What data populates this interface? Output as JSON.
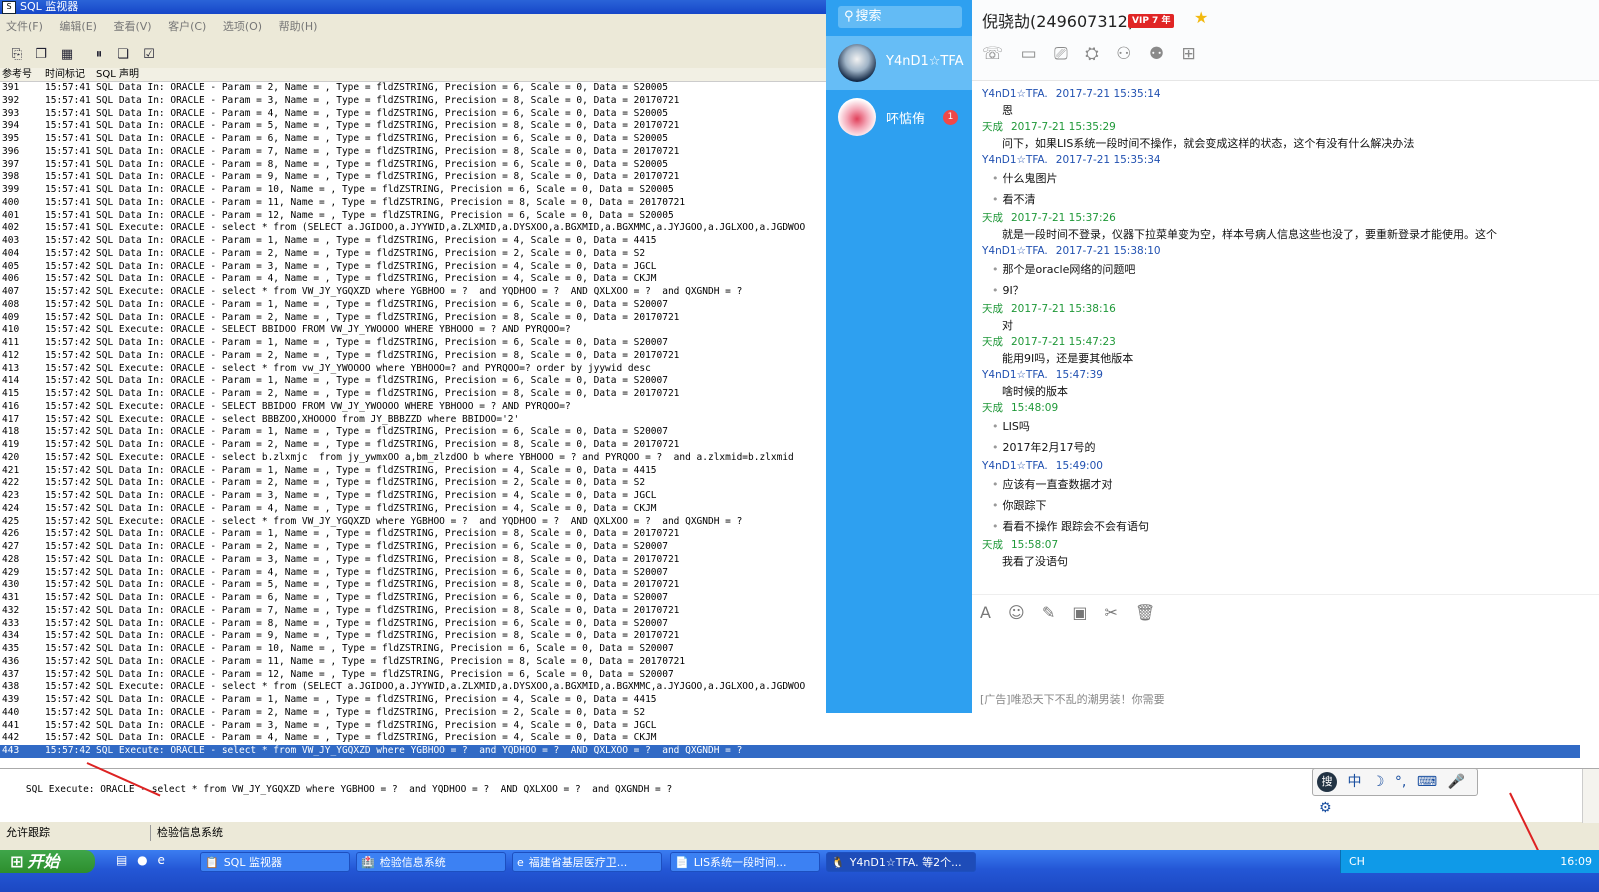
{
  "sql_window": {
    "title": "SQL 监视器",
    "menu": [
      "文件(F)",
      "编辑(E)",
      "查看(V)",
      "客户(C)",
      "选项(O)",
      "帮助(H)"
    ],
    "columns": [
      "参考号",
      "时间标记",
      "SQL 声明"
    ],
    "rows": [
      [
        "391",
        "15:57:41",
        "SQL Data In: ORACLE - Param = 2, Name = , Type = fldZSTRING, Precision = 6, Scale = 0, Data = S20005"
      ],
      [
        "392",
        "15:57:41",
        "SQL Data In: ORACLE - Param = 3, Name = , Type = fldZSTRING, Precision = 8, Scale = 0, Data = 20170721"
      ],
      [
        "393",
        "15:57:41",
        "SQL Data In: ORACLE - Param = 4, Name = , Type = fldZSTRING, Precision = 6, Scale = 0, Data = S20005"
      ],
      [
        "394",
        "15:57:41",
        "SQL Data In: ORACLE - Param = 5, Name = , Type = fldZSTRING, Precision = 8, Scale = 0, Data = 20170721"
      ],
      [
        "395",
        "15:57:41",
        "SQL Data In: ORACLE - Param = 6, Name = , Type = fldZSTRING, Precision = 6, Scale = 0, Data = S20005"
      ],
      [
        "396",
        "15:57:41",
        "SQL Data In: ORACLE - Param = 7, Name = , Type = fldZSTRING, Precision = 8, Scale = 0, Data = 20170721"
      ],
      [
        "397",
        "15:57:41",
        "SQL Data In: ORACLE - Param = 8, Name = , Type = fldZSTRING, Precision = 6, Scale = 0, Data = S20005"
      ],
      [
        "398",
        "15:57:41",
        "SQL Data In: ORACLE - Param = 9, Name = , Type = fldZSTRING, Precision = 8, Scale = 0, Data = 20170721"
      ],
      [
        "399",
        "15:57:41",
        "SQL Data In: ORACLE - Param = 10, Name = , Type = fldZSTRING, Precision = 6, Scale = 0, Data = S20005"
      ],
      [
        "400",
        "15:57:41",
        "SQL Data In: ORACLE - Param = 11, Name = , Type = fldZSTRING, Precision = 8, Scale = 0, Data = 20170721"
      ],
      [
        "401",
        "15:57:41",
        "SQL Data In: ORACLE - Param = 12, Name = , Type = fldZSTRING, Precision = 6, Scale = 0, Data = S20005"
      ],
      [
        "402",
        "15:57:41",
        "SQL Execute: ORACLE - select * from (SELECT a.JGIDOO,a.JYYWID,a.ZLXMID,a.DYSXOO,a.BGXMID,a.BGXMMC,a.JYJGOO,a.JGLXOO,a.JGDWOO"
      ],
      [
        "403",
        "15:57:42",
        "SQL Data In: ORACLE - Param = 1, Name = , Type = fldZSTRING, Precision = 4, Scale = 0, Data = 4415"
      ],
      [
        "404",
        "15:57:42",
        "SQL Data In: ORACLE - Param = 2, Name = , Type = fldZSTRING, Precision = 2, Scale = 0, Data = S2"
      ],
      [
        "405",
        "15:57:42",
        "SQL Data In: ORACLE - Param = 3, Name = , Type = fldZSTRING, Precision = 4, Scale = 0, Data = JGCL"
      ],
      [
        "406",
        "15:57:42",
        "SQL Data In: ORACLE - Param = 4, Name = , Type = fldZSTRING, Precision = 4, Scale = 0, Data = CKJM"
      ],
      [
        "407",
        "15:57:42",
        "SQL Execute: ORACLE - select * from VW_JY_YGQXZD where YGBHOO = ?  and YQDHOO = ?  AND QXLXOO = ?  and QXGNDH = ?"
      ],
      [
        "408",
        "15:57:42",
        "SQL Data In: ORACLE - Param = 1, Name = , Type = fldZSTRING, Precision = 6, Scale = 0, Data = S20007"
      ],
      [
        "409",
        "15:57:42",
        "SQL Data In: ORACLE - Param = 2, Name = , Type = fldZSTRING, Precision = 8, Scale = 0, Data = 20170721"
      ],
      [
        "410",
        "15:57:42",
        "SQL Execute: ORACLE - SELECT BBIDOO FROM VW_JY_YWOOOO WHERE YBHOOO = ? AND PYRQOO=?"
      ],
      [
        "411",
        "15:57:42",
        "SQL Data In: ORACLE - Param = 1, Name = , Type = fldZSTRING, Precision = 6, Scale = 0, Data = S20007"
      ],
      [
        "412",
        "15:57:42",
        "SQL Data In: ORACLE - Param = 2, Name = , Type = fldZSTRING, Precision = 8, Scale = 0, Data = 20170721"
      ],
      [
        "413",
        "15:57:42",
        "SQL Execute: ORACLE - select * from vw_JY_YWOOOO where YBHOOO=? and PYRQOO=? order by jyywid desc"
      ],
      [
        "414",
        "15:57:42",
        "SQL Data In: ORACLE - Param = 1, Name = , Type = fldZSTRING, Precision = 6, Scale = 0, Data = S20007"
      ],
      [
        "415",
        "15:57:42",
        "SQL Data In: ORACLE - Param = 2, Name = , Type = fldZSTRING, Precision = 8, Scale = 0, Data = 20170721"
      ],
      [
        "416",
        "15:57:42",
        "SQL Execute: ORACLE - SELECT BBIDOO FROM VW_JY_YWOOOO WHERE YBHOOO = ? AND PYRQOO=?"
      ],
      [
        "417",
        "15:57:42",
        "SQL Execute: ORACLE - select BBBZOO,XHOOOO from JY_BBBZZD where BBIDOO='2'"
      ],
      [
        "418",
        "15:57:42",
        "SQL Data In: ORACLE - Param = 1, Name = , Type = fldZSTRING, Precision = 6, Scale = 0, Data = S20007"
      ],
      [
        "419",
        "15:57:42",
        "SQL Data In: ORACLE - Param = 2, Name = , Type = fldZSTRING, Precision = 8, Scale = 0, Data = 20170721"
      ],
      [
        "420",
        "15:57:42",
        "SQL Execute: ORACLE - select b.zlxmjc  from jy_ywmxOO a,bm_zlzdOO b where YBHOOO = ? and PYRQOO = ?  and a.zlxmid=b.zlxmid"
      ],
      [
        "421",
        "15:57:42",
        "SQL Data In: ORACLE - Param = 1, Name = , Type = fldZSTRING, Precision = 4, Scale = 0, Data = 4415"
      ],
      [
        "422",
        "15:57:42",
        "SQL Data In: ORACLE - Param = 2, Name = , Type = fldZSTRING, Precision = 2, Scale = 0, Data = S2"
      ],
      [
        "423",
        "15:57:42",
        "SQL Data In: ORACLE - Param = 3, Name = , Type = fldZSTRING, Precision = 4, Scale = 0, Data = JGCL"
      ],
      [
        "424",
        "15:57:42",
        "SQL Data In: ORACLE - Param = 4, Name = , Type = fldZSTRING, Precision = 4, Scale = 0, Data = CKJM"
      ],
      [
        "425",
        "15:57:42",
        "SQL Execute: ORACLE - select * from VW_JY_YGQXZD where YGBHOO = ?  and YQDHOO = ?  AND QXLXOO = ?  and QXGNDH = ?"
      ],
      [
        "426",
        "15:57:42",
        "SQL Data In: ORACLE - Param = 1, Name = , Type = fldZSTRING, Precision = 8, Scale = 0, Data = 20170721"
      ],
      [
        "427",
        "15:57:42",
        "SQL Data In: ORACLE - Param = 2, Name = , Type = fldZSTRING, Precision = 6, Scale = 0, Data = S20007"
      ],
      [
        "428",
        "15:57:42",
        "SQL Data In: ORACLE - Param = 3, Name = , Type = fldZSTRING, Precision = 8, Scale = 0, Data = 20170721"
      ],
      [
        "429",
        "15:57:42",
        "SQL Data In: ORACLE - Param = 4, Name = , Type = fldZSTRING, Precision = 6, Scale = 0, Data = S20007"
      ],
      [
        "430",
        "15:57:42",
        "SQL Data In: ORACLE - Param = 5, Name = , Type = fldZSTRING, Precision = 8, Scale = 0, Data = 20170721"
      ],
      [
        "431",
        "15:57:42",
        "SQL Data In: ORACLE - Param = 6, Name = , Type = fldZSTRING, Precision = 6, Scale = 0, Data = S20007"
      ],
      [
        "432",
        "15:57:42",
        "SQL Data In: ORACLE - Param = 7, Name = , Type = fldZSTRING, Precision = 8, Scale = 0, Data = 20170721"
      ],
      [
        "433",
        "15:57:42",
        "SQL Data In: ORACLE - Param = 8, Name = , Type = fldZSTRING, Precision = 6, Scale = 0, Data = S20007"
      ],
      [
        "434",
        "15:57:42",
        "SQL Data In: ORACLE - Param = 9, Name = , Type = fldZSTRING, Precision = 8, Scale = 0, Data = 20170721"
      ],
      [
        "435",
        "15:57:42",
        "SQL Data In: ORACLE - Param = 10, Name = , Type = fldZSTRING, Precision = 6, Scale = 0, Data = S20007"
      ],
      [
        "436",
        "15:57:42",
        "SQL Data In: ORACLE - Param = 11, Name = , Type = fldZSTRING, Precision = 8, Scale = 0, Data = 20170721"
      ],
      [
        "437",
        "15:57:42",
        "SQL Data In: ORACLE - Param = 12, Name = , Type = fldZSTRING, Precision = 6, Scale = 0, Data = S20007"
      ],
      [
        "438",
        "15:57:42",
        "SQL Execute: ORACLE - select * from (SELECT a.JGIDOO,a.JYYWID,a.ZLXMID,a.DYSXOO,a.BGXMID,a.BGXMMC,a.JYJGOO,a.JGLXOO,a.JGDWOO"
      ],
      [
        "439",
        "15:57:42",
        "SQL Data In: ORACLE - Param = 1, Name = , Type = fldZSTRING, Precision = 4, Scale = 0, Data = 4415"
      ],
      [
        "440",
        "15:57:42",
        "SQL Data In: ORACLE - Param = 2, Name = , Type = fldZSTRING, Precision = 2, Scale = 0, Data = S2"
      ],
      [
        "441",
        "15:57:42",
        "SQL Data In: ORACLE - Param = 3, Name = , Type = fldZSTRING, Precision = 4, Scale = 0, Data = JGCL"
      ],
      [
        "442",
        "15:57:42",
        "SQL Data In: ORACLE - Param = 4, Name = , Type = fldZSTRING, Precision = 4, Scale = 0, Data = CKJM"
      ],
      [
        "443",
        "15:57:42",
        "SQL Execute: ORACLE - select * from VW_JY_YGQXZD where YGBHOO = ?  and YQDHOO = ?  AND QXLXOO = ?  and QXGNDH = ?"
      ]
    ],
    "selected_row": "443",
    "detail": "SQL Execute: ORACLE - select * from VW_JY_YGQXZD where YGBHOO = ?  and YQDHOO = ?  AND QXLXOO = ?  and QXGNDH = ?",
    "status_left": "允许跟踪",
    "status_right": "检验信息系统"
  },
  "ime": {
    "logo": "搜",
    "items": [
      "中",
      "☽",
      "°,",
      "⌨",
      "🎤",
      "⚙"
    ]
  },
  "qq": {
    "search_placeholder": "搜索",
    "contacts": [
      {
        "name": "Y4nD1☆TFA",
        "active": true
      },
      {
        "name": "吥惦侑",
        "badge": "1",
        "active": false
      }
    ],
    "chat_title": "倪骁劼(249607312)",
    "vip_label": "VIP 7 年",
    "messages": [
      {
        "kind": "meta",
        "sender": "Y4nD1☆TFA.",
        "time": "2017-7-21 15:35:14",
        "side": "me"
      },
      {
        "kind": "text",
        "text": "恩"
      },
      {
        "kind": "meta",
        "sender": "天成",
        "time": "2017-7-21 15:35:29",
        "side": "them"
      },
      {
        "kind": "text",
        "text": "问下，如果LIS系统一段时间不操作，就会变成这样的状态，这个有没有什么解决办法"
      },
      {
        "kind": "meta",
        "sender": "Y4nD1☆TFA.",
        "time": "2017-7-21 15:35:34",
        "side": "me"
      },
      {
        "kind": "bullet",
        "text": "什么鬼图片"
      },
      {
        "kind": "bullet",
        "text": "看不清"
      },
      {
        "kind": "meta",
        "sender": "天成",
        "time": "2017-7-21 15:37:26",
        "side": "them"
      },
      {
        "kind": "text",
        "text": "就是一段时间不登录，仪器下拉菜单变为空，样本号病人信息这些也没了，要重新登录才能使用。这个"
      },
      {
        "kind": "meta",
        "sender": "Y4nD1☆TFA.",
        "time": "2017-7-21 15:38:10",
        "side": "me"
      },
      {
        "kind": "bullet",
        "text": "那个是oracle网络的问题吧"
      },
      {
        "kind": "bullet",
        "text": "9I？"
      },
      {
        "kind": "meta",
        "sender": "天成",
        "time": "2017-7-21 15:38:16",
        "side": "them"
      },
      {
        "kind": "text",
        "text": "对"
      },
      {
        "kind": "meta",
        "sender": "天成",
        "time": "2017-7-21 15:47:23",
        "side": "them"
      },
      {
        "kind": "text",
        "text": "能用9I吗，还是要其他版本"
      },
      {
        "kind": "meta",
        "sender": "Y4nD1☆TFA.",
        "time": "15:47:39",
        "side": "me"
      },
      {
        "kind": "text",
        "text": "啥时候的版本"
      },
      {
        "kind": "meta",
        "sender": "天成",
        "time": "15:48:09",
        "side": "them"
      },
      {
        "kind": "bullet",
        "text": "LIS吗"
      },
      {
        "kind": "bullet",
        "text": "2017年2月17号的"
      },
      {
        "kind": "meta",
        "sender": "Y4nD1☆TFA.",
        "time": "15:49:00",
        "side": "me"
      },
      {
        "kind": "bullet",
        "text": "应该有一直查数据才对"
      },
      {
        "kind": "bullet",
        "text": "你跟踪下"
      },
      {
        "kind": "bullet",
        "text": "看看不操作  跟踪会不会有语句"
      },
      {
        "kind": "meta",
        "sender": "天成",
        "time": "15:58:07",
        "side": "them"
      },
      {
        "kind": "text",
        "text": "我看了没语句"
      }
    ],
    "ad": "[广告]唯恐天下不乱的潮男装！你需要"
  },
  "taskbar": {
    "start": "开始",
    "items": [
      {
        "label": "SQL 监视器",
        "icon": "📋"
      },
      {
        "label": "检验信息系统",
        "icon": "🏥"
      },
      {
        "label": "福建省基层医疗卫...",
        "icon": "e"
      },
      {
        "label": "LIS系统一段时间...",
        "icon": "📄"
      },
      {
        "label": "Y4nD1☆TFA. 等2个...",
        "icon": "🐧"
      }
    ],
    "lang": "CH",
    "clock": "16:09"
  }
}
